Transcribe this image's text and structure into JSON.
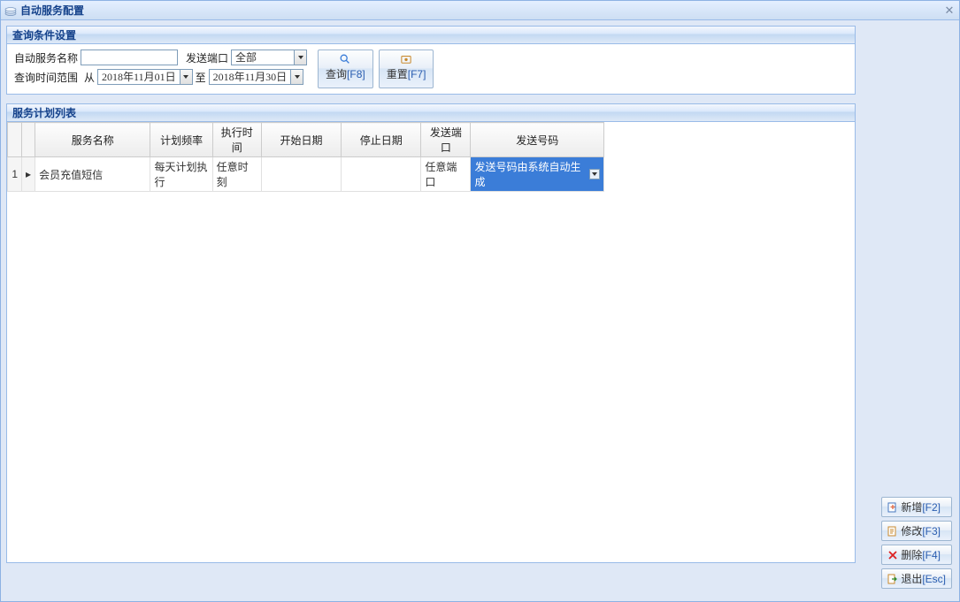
{
  "window": {
    "title": "自动服务配置"
  },
  "query": {
    "header": "查询条件设置",
    "service_name_label": "自动服务名称",
    "service_name_value": "",
    "port_label": "发送端口",
    "port_value": "全部",
    "time_range_label": "查询时间范围",
    "from_label": "从",
    "from_value": "2018年11月01日",
    "to_label": "至",
    "to_value": "2018年11月30日",
    "search_label": "查询",
    "search_hotkey": "[F8]",
    "reset_label": "重置",
    "reset_hotkey": "[F7]"
  },
  "list": {
    "header": "服务计划列表",
    "columns": {
      "name": "服务名称",
      "freq": "计划频率",
      "exec": "执行时间",
      "start": "开始日期",
      "end": "停止日期",
      "port": "发送端口",
      "num": "发送号码"
    },
    "rows": [
      {
        "rownum": "1",
        "name": "会员充值短信",
        "freq": "每天计划执行",
        "exec": "任意时刻",
        "start": "",
        "end": "",
        "port": "任意端口",
        "num": "发送号码由系统自动生成"
      }
    ]
  },
  "side": {
    "add_label": "新增",
    "add_hk": "[F2]",
    "edit_label": "修改",
    "edit_hk": "[F3]",
    "del_label": "删除",
    "del_hk": "[F4]",
    "exit_label": "退出",
    "exit_hk": "[Esc]"
  }
}
